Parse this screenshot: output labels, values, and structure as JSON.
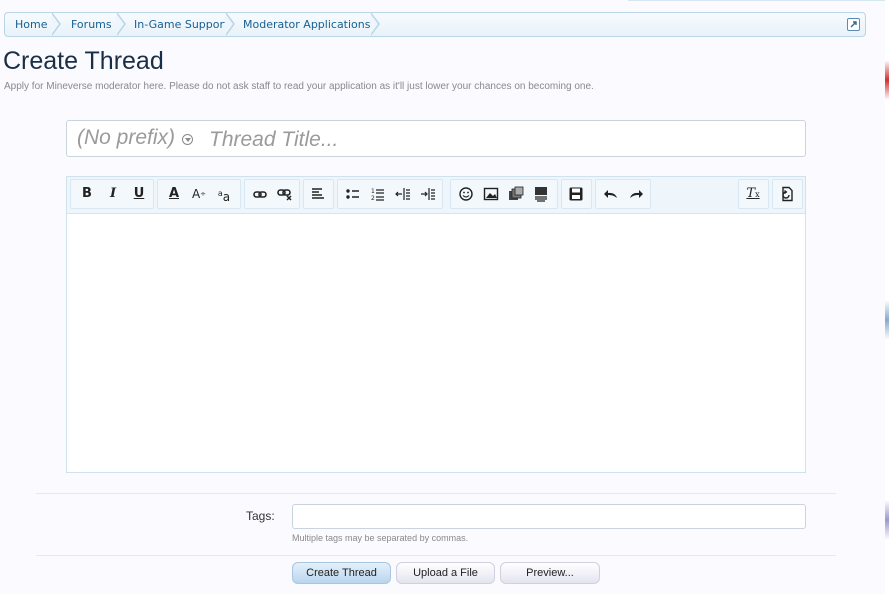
{
  "breadcrumb": {
    "items": [
      {
        "label": "Home"
      },
      {
        "label": "Forums"
      },
      {
        "label": "In-Game Support"
      },
      {
        "label": "Moderator Applications"
      }
    ]
  },
  "page": {
    "title": "Create Thread",
    "description": "Apply for Mineverse moderator here. Please do not ask staff to read your application as it'll just lower your chances on becoming one."
  },
  "thread_form": {
    "prefix": "(No prefix)",
    "title_placeholder": "Thread Title..."
  },
  "editor": {
    "toolbar_icons": [
      "bold-icon",
      "italic-icon",
      "underline-icon",
      "text-color-icon",
      "font-size-icon",
      "font-family-icon",
      "link-icon",
      "unlink-icon",
      "align-icon",
      "bullet-list-icon",
      "numbered-list-icon",
      "outdent-icon",
      "indent-icon",
      "smilie-icon",
      "image-icon",
      "media-icon",
      "insert-icon",
      "save-draft-icon",
      "undo-icon",
      "redo-icon",
      "remove-format-icon",
      "toggle-bbcode-icon"
    ],
    "body": ""
  },
  "tags": {
    "label": "Tags:",
    "value": "",
    "hint": "Multiple tags may be separated by commas."
  },
  "actions": {
    "create_label": "Create Thread",
    "upload_label": "Upload a File",
    "preview_label": "Preview..."
  },
  "colors": {
    "link": "#176093",
    "title": "#1a2f45",
    "toolbar_bg": "#eef5fb",
    "primary_button": "#b9d6ee"
  }
}
